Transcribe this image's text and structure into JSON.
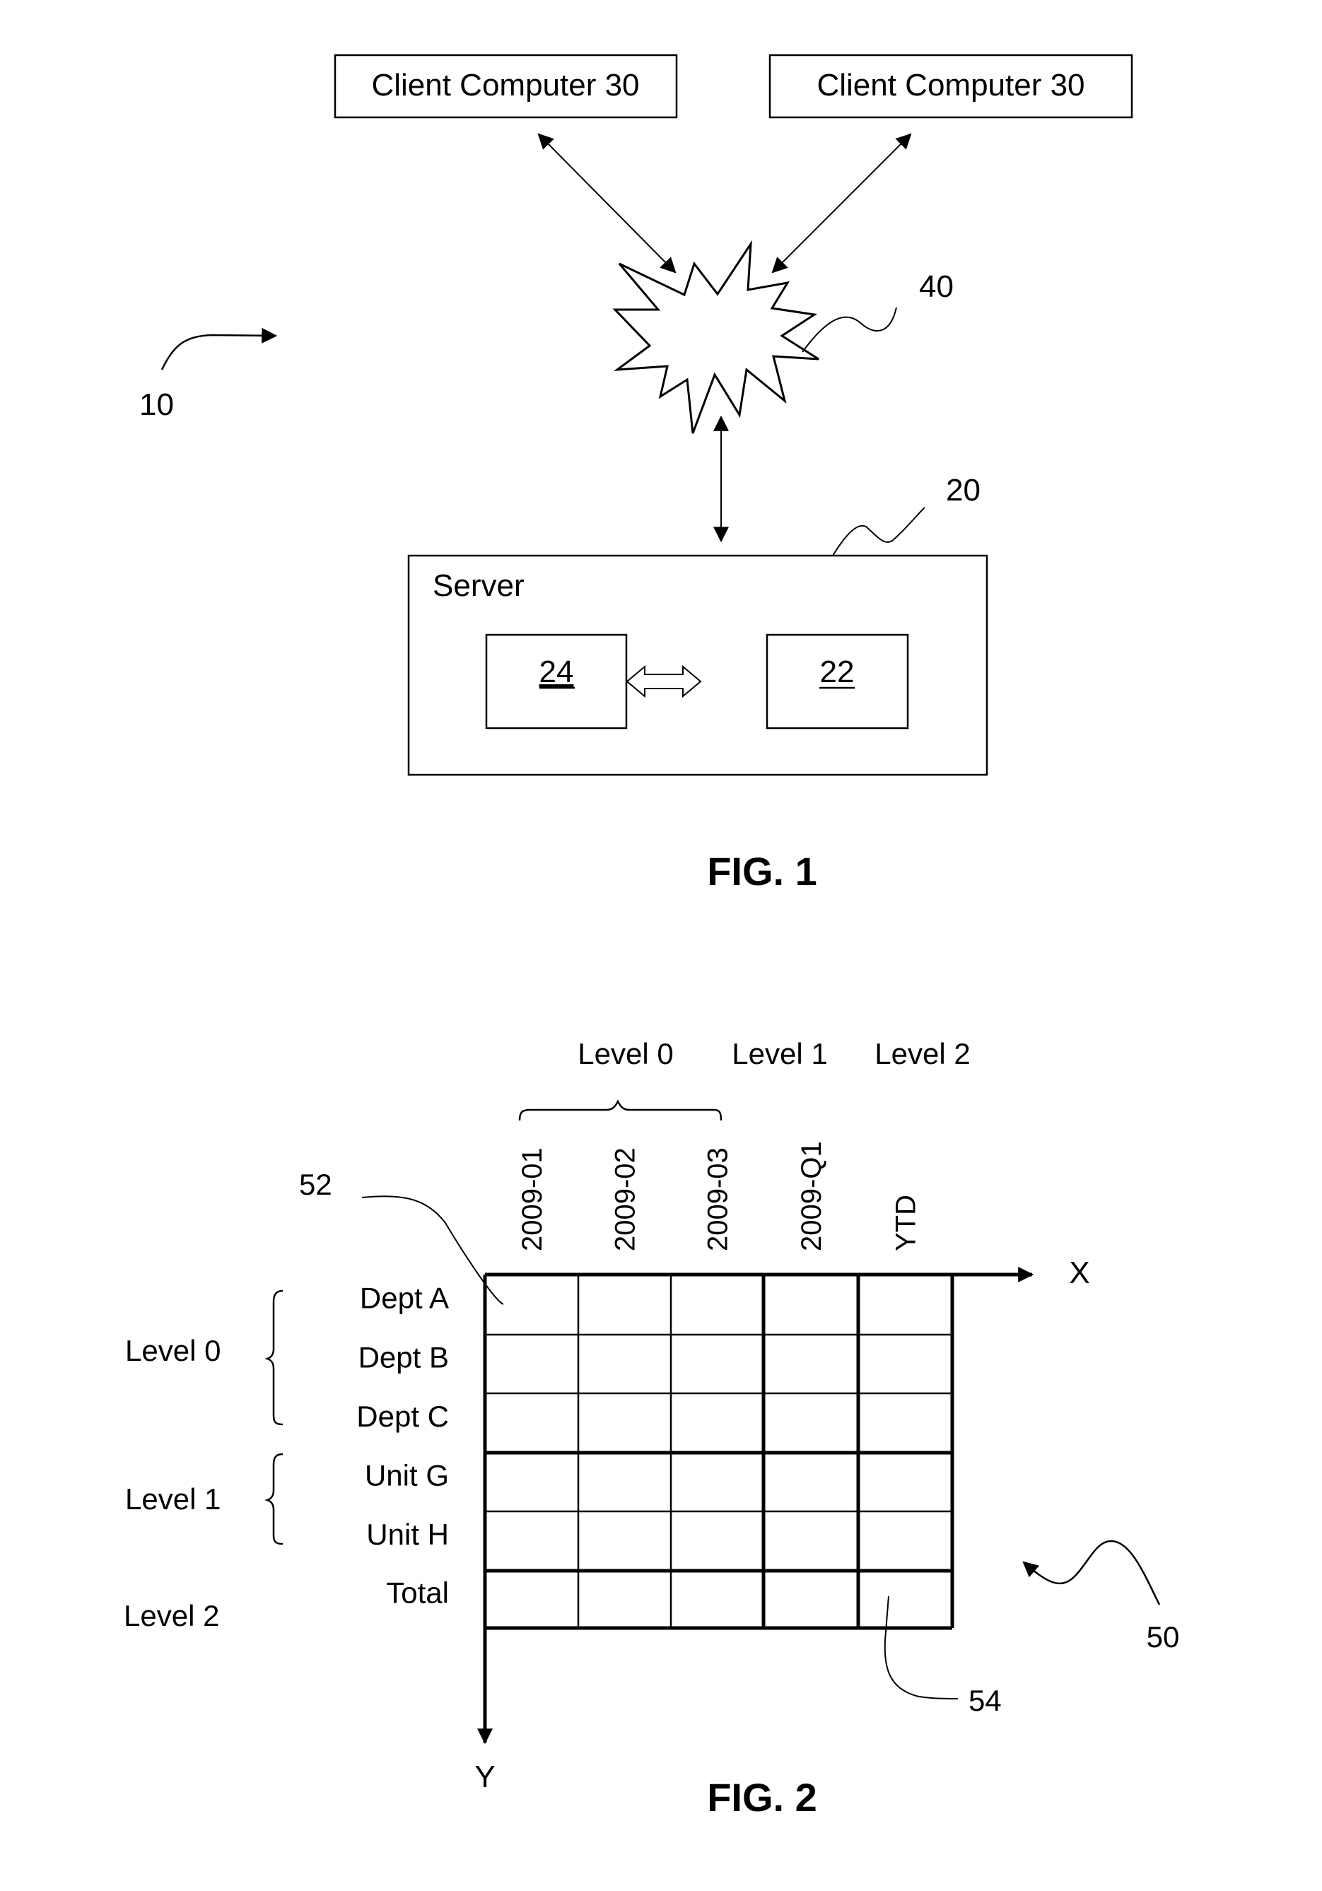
{
  "figure1": {
    "caption": "FIG. 1",
    "system_ref": "10",
    "clients": [
      {
        "label": "Client Computer 30"
      },
      {
        "label": "Client Computer 30"
      }
    ],
    "network_ref": "40",
    "server": {
      "ref": "20",
      "label": "Server",
      "components": [
        {
          "ref": "24"
        },
        {
          "ref": "22"
        }
      ]
    }
  },
  "figure2": {
    "caption": "FIG. 2",
    "grid_ref": "50",
    "cell_ref_first": "52",
    "cell_ref_last": "54",
    "x_axis_label": "X",
    "y_axis_label": "Y",
    "column_levels": [
      "Level 0",
      "Level 1",
      "Level 2"
    ],
    "columns": [
      "2009-01",
      "2009-02",
      "2009-03",
      "2009-Q1",
      "YTD"
    ],
    "row_levels": [
      "Level 0",
      "Level 1",
      "Level 2"
    ],
    "rows": [
      "Dept A",
      "Dept B",
      "Dept C",
      "Unit G",
      "Unit H",
      "Total"
    ]
  }
}
